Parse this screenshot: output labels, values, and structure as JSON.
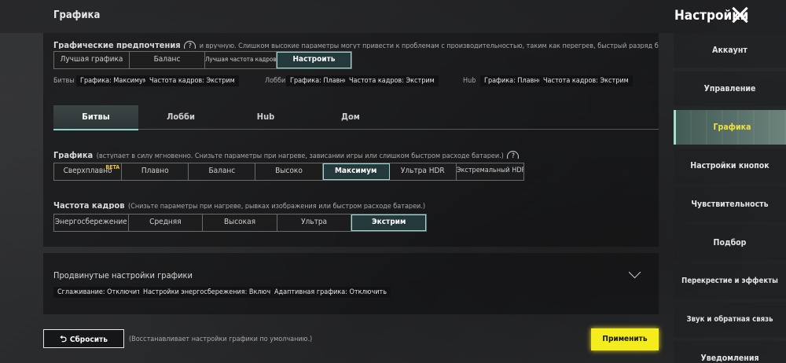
{
  "page_label": "Графика",
  "header": {
    "title": "Настройки"
  },
  "prefs": {
    "title": "Графические предпочтения",
    "hint": "?",
    "desc": "и вручную. Слишком высокие параметры могут привести к проблемам с производительностью, таким как перегрев, быстрый разряд батареи или подвисание к",
    "options": [
      "Лучшая графика",
      "Баланс",
      "Лучшая частота кадров",
      "Настроить"
    ],
    "active_index": 3
  },
  "summary": [
    {
      "label": "Битвы",
      "graphics": "Графика: Максимум",
      "fps": "Частота кадров: Экстрим"
    },
    {
      "label": "Лобби",
      "graphics": "Графика: Плавно",
      "fps": "Частота кадров: Экстрим"
    },
    {
      "label": "Hub",
      "graphics": "Графика: Плавно",
      "fps": "Частота кадров: Экстрим"
    }
  ],
  "tabs": [
    "Битвы",
    "Лобби",
    "Hub",
    "Дом"
  ],
  "active_tab": 0,
  "graphics": {
    "title": "Графика",
    "desc": "(вступает в силу мгновенно. Снизьте параметры при нагреве, зависании игры или слишком быстром расходе батареи.)",
    "hint": "?",
    "options": [
      "Сверхплавно",
      "Плавно",
      "Баланс",
      "Высоко",
      "Максимум",
      "Ультра HDR",
      "Экстремальный HDR"
    ],
    "beta": "BETA",
    "active_index": 4
  },
  "fps": {
    "title": "Частота кадров",
    "desc": "(Снизьте параметры при нагреве, рывках изображения или быстром расходе батареи.)",
    "options": [
      "Энергосбережение",
      "Средняя",
      "Высокая",
      "Ультра",
      "Экстрим"
    ],
    "active_index": 4
  },
  "advanced": {
    "title": "Продвинутые настройки графики",
    "tags": [
      "Сглаживание: Отключить",
      "Настройки энергосбережения: Включить",
      "Адаптивная графика: Отключить"
    ]
  },
  "footer": {
    "reset_label": "Сбросить",
    "reset_note": "(Восстанавливает настройки графики по умолчанию.)",
    "apply_label": "Применить"
  },
  "sidebar": {
    "items": [
      "Аккаунт",
      "Управление",
      "Графика",
      "Настройки кнопок",
      "Чувствительность",
      "Подбор",
      "Перекрестие и эффекты",
      "Звук и обратная связь",
      "Уведомления"
    ],
    "active_index": 2
  },
  "colors": {
    "accent": "#9ad7d0",
    "apply": "#f5ec1d",
    "active_sidebar_text": "#f3e23a"
  }
}
